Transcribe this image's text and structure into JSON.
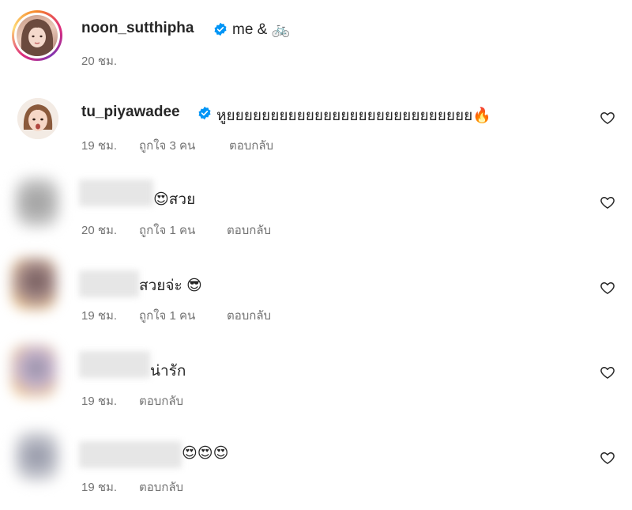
{
  "post": {
    "username": "noon_sutthipha",
    "caption": "me & 🚲",
    "time": "20 ชม."
  },
  "comments": [
    {
      "username": "tu_piyawadee",
      "text": "หูยยยยยยยยยยยยยยยยยยยยยยยยยยยย🔥",
      "time": "19 ชม.",
      "likes": "ถูกใจ 3 คน",
      "reply": "ตอบกลับ"
    },
    {
      "text": "😍สวย",
      "time": "20 ชม.",
      "likes": "ถูกใจ 1 คน",
      "reply": "ตอบกลับ"
    },
    {
      "text": "สวยจ่ะ 😎",
      "time": "19 ชม.",
      "likes": "ถูกใจ 1 คน",
      "reply": "ตอบกลับ"
    },
    {
      "text": "น่ารัก",
      "time": "19 ชม.",
      "reply": "ตอบกลับ"
    },
    {
      "text": "😍😍😍",
      "time": "19 ชม.",
      "reply": "ตอบกลับ"
    }
  ],
  "icons": {
    "verified": "verified-badge-icon",
    "like": "heart-icon"
  },
  "colors": {
    "verified": "#0095f6",
    "secondary_text": "#737373",
    "primary_text": "#262626"
  }
}
